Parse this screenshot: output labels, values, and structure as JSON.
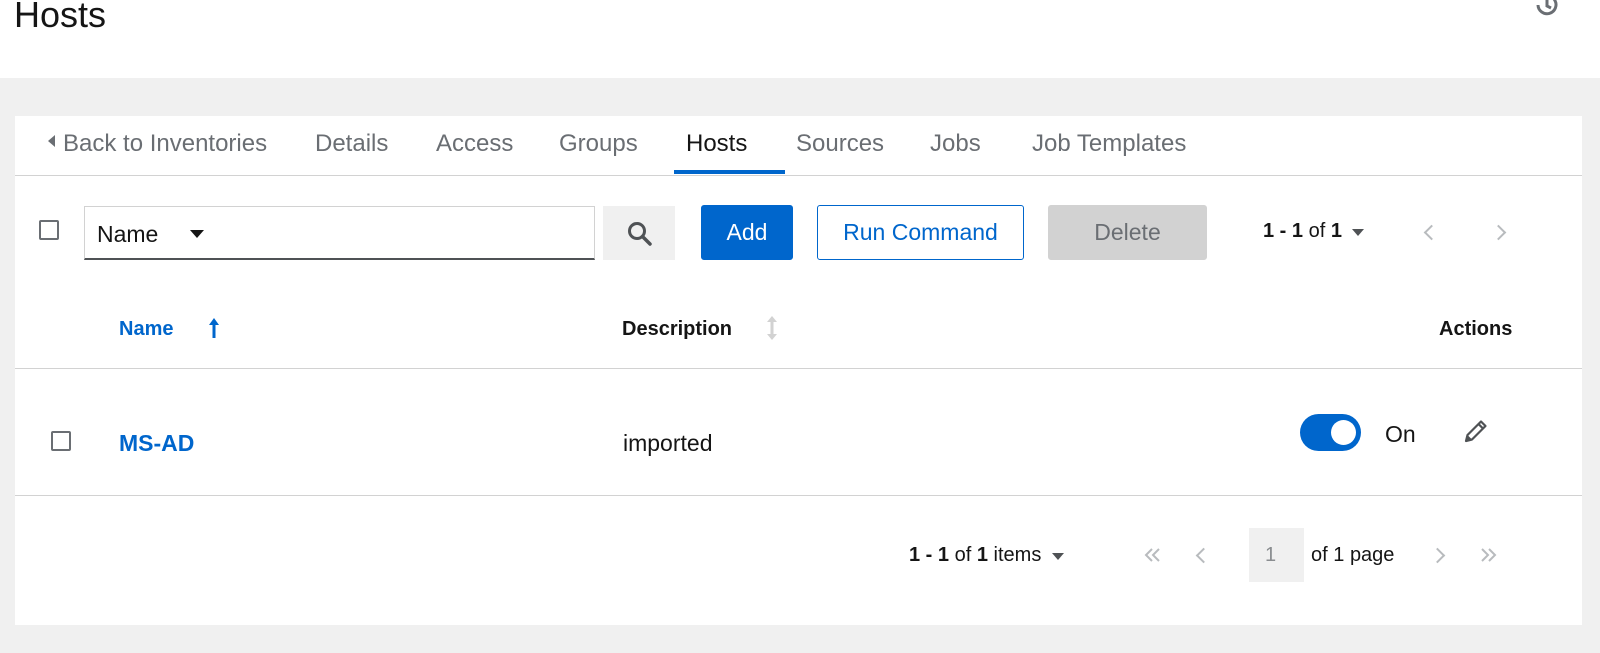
{
  "header": {
    "title": "Hosts",
    "history_icon": "history-icon"
  },
  "tabs": [
    {
      "label": "Back to Inventories",
      "active": false
    },
    {
      "label": "Details",
      "active": false
    },
    {
      "label": "Access",
      "active": false
    },
    {
      "label": "Groups",
      "active": false
    },
    {
      "label": "Hosts",
      "active": true
    },
    {
      "label": "Sources",
      "active": false
    },
    {
      "label": "Jobs",
      "active": false
    },
    {
      "label": "Job Templates",
      "active": false
    }
  ],
  "toolbar": {
    "filter_select": "Name",
    "search_value": "",
    "add_label": "Add",
    "run_command_label": "Run Command",
    "delete_label": "Delete",
    "pagination": {
      "range": "1 - 1",
      "of_word": "of",
      "total": "1"
    }
  },
  "table": {
    "columns": [
      {
        "label": "Name",
        "sort": "ascending"
      },
      {
        "label": "Description",
        "sort": "none"
      },
      {
        "label": "Actions"
      }
    ],
    "rows": [
      {
        "name": "MS-AD",
        "description": "imported",
        "enabled": true,
        "toggle_label": "On"
      }
    ]
  },
  "footer_pagination": {
    "range": "1 - 1",
    "of_word": "of",
    "total": "1",
    "items_word": "items",
    "current_page": "1",
    "of_pages": "of",
    "page_count": "1",
    "page_word": "page"
  },
  "colors": {
    "accent": "#0066cc",
    "page_bg": "#f0f0f0",
    "disabled_bg": "#d2d2d2"
  }
}
